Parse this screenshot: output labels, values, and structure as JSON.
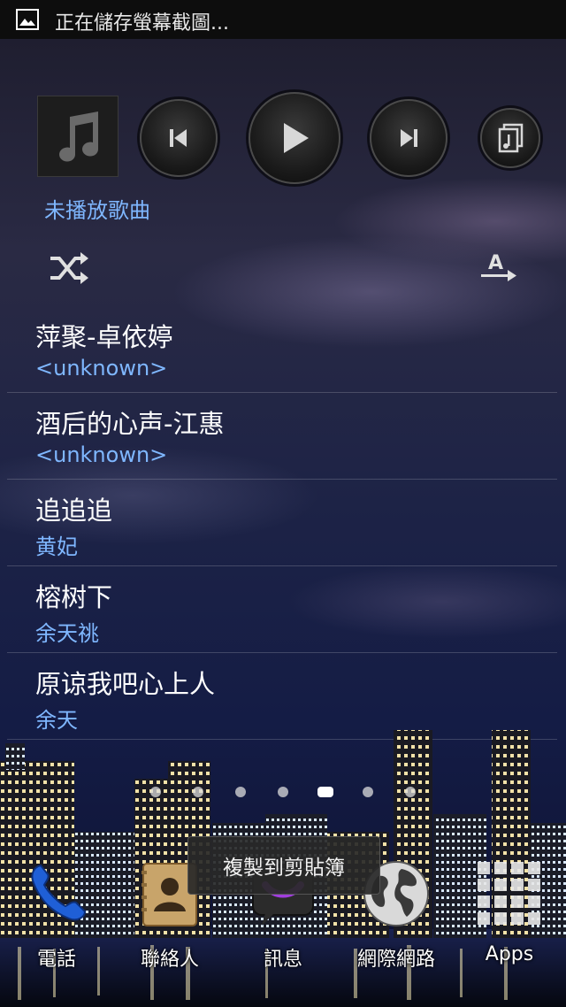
{
  "status_bar": {
    "notification_text": "正在儲存螢幕截圖..."
  },
  "music_widget": {
    "now_playing": "未播放歌曲",
    "icons": {
      "album_art": "music-note-icon",
      "previous": "previous-icon",
      "play": "play-icon",
      "next": "next-icon",
      "playlist": "playlist-icon",
      "shuffle": "shuffle-icon",
      "sort": "sort-alphabetical-icon"
    }
  },
  "songs": [
    {
      "title": "萍聚-卓依婷",
      "artist": "<unknown>"
    },
    {
      "title": "酒后的心声-江惠",
      "artist": "<unknown>"
    },
    {
      "title": "追追追",
      "artist": "黄妃"
    },
    {
      "title": "榕树下",
      "artist": "余天祧"
    },
    {
      "title": "原谅我吧心上人",
      "artist": "余天"
    }
  ],
  "page_indicator": {
    "pages": 7,
    "active_index": 4
  },
  "dock": [
    {
      "label": "電話",
      "icon": "phone-icon"
    },
    {
      "label": "聯絡人",
      "icon": "contacts-icon"
    },
    {
      "label": "訊息",
      "icon": "messages-icon"
    },
    {
      "label": "網際網路",
      "icon": "globe-icon"
    },
    {
      "label": "Apps",
      "icon": "apps-grid-icon"
    }
  ],
  "toast": {
    "text": "複製到剪貼簿"
  },
  "colors": {
    "accent_blue": "#7fb7ff",
    "status_bar": "#0d0d0d"
  }
}
